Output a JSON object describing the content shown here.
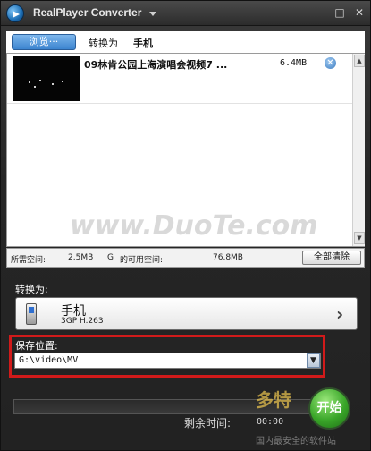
{
  "window": {
    "title": "RealPlayer Converter",
    "controls": {
      "minimize": "—",
      "maximize": "□",
      "close": "✕"
    }
  },
  "topbar": {
    "browse_label": "浏览···",
    "convert_to_label": "转换为",
    "convert_to_value": "手机"
  },
  "list": {
    "items": [
      {
        "title": "09林肯公园上海演唱会视频7  ...",
        "size": "6.4MB",
        "remove_icon": "✕"
      }
    ],
    "watermark": "www.DuoTe.com"
  },
  "space": {
    "required_label": "所需空间:",
    "required_value": "2.5MB",
    "drive": "G",
    "available_label": "的可用空间:",
    "available_value": "76.8MB",
    "clear_all_label": "全部清除"
  },
  "convert": {
    "section_label": "转换为:",
    "device_name": "手机",
    "device_format": "3GP H.263",
    "chevron": "›"
  },
  "save": {
    "section_label": "保存位置:",
    "path": "G:\\video\\MV",
    "dropdown_icon": "▼"
  },
  "progress": {
    "remaining_label": "剩余时间:",
    "remaining_value": "00:00",
    "start_label": "开始",
    "progress_fraction": 0
  },
  "branding": {
    "logo_text": "多特",
    "logo_sub": "国内最安全的软件站"
  }
}
